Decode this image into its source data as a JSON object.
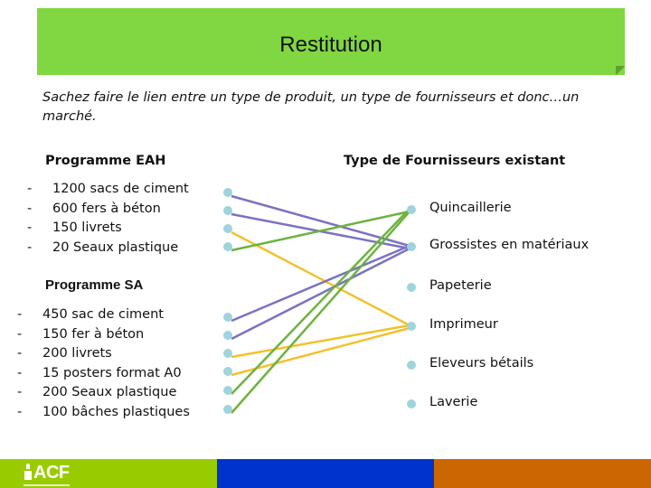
{
  "title": "Restitution",
  "intro": "Sachez faire le lien entre un type de produit, un type de fournisseurs et donc…un marché.",
  "programs": {
    "eah": {
      "heading": "Programme EAH",
      "items": [
        "1200 sacs de ciment",
        "600 fers à béton",
        "150 livrets",
        "20 Seaux plastique"
      ]
    },
    "sa": {
      "heading": "Programme SA",
      "items": [
        "450 sac de ciment",
        "150 fer à béton",
        "200 livrets",
        "15 posters format A0",
        "200 Seaux plastique",
        "100 bâches plastiques"
      ]
    }
  },
  "suppliers": {
    "heading": "Type de Fournisseurs existant",
    "items": [
      "Quincaillerie",
      "Grossistes en matériaux",
      "Papeterie",
      "Imprimeur",
      "Eleveurs bétails",
      "Laverie"
    ]
  },
  "bullet_marker": "-",
  "colors": {
    "banner": "#80d742",
    "node": "#9fd4dc",
    "link_purple": "#7b73c0",
    "link_green": "#6db33f",
    "link_yellow": "#f2c12e",
    "footer_green": "#99cc00",
    "footer_blue": "#0033cc",
    "footer_orange": "#cc6600"
  },
  "links": [
    {
      "from": "eah.0",
      "to": "supplier.1",
      "color": "link_purple"
    },
    {
      "from": "eah.1",
      "to": "supplier.1",
      "color": "link_purple"
    },
    {
      "from": "eah.2",
      "to": "supplier.3",
      "color": "link_yellow"
    },
    {
      "from": "eah.3",
      "to": "supplier.0",
      "color": "link_green"
    },
    {
      "from": "sa.0",
      "to": "supplier.1",
      "color": "link_purple"
    },
    {
      "from": "sa.1",
      "to": "supplier.1",
      "color": "link_purple"
    },
    {
      "from": "sa.2",
      "to": "supplier.3",
      "color": "link_yellow"
    },
    {
      "from": "sa.3",
      "to": "supplier.3",
      "color": "link_yellow"
    },
    {
      "from": "sa.4",
      "to": "supplier.0",
      "color": "link_green"
    },
    {
      "from": "sa.5",
      "to": "supplier.0",
      "color": "link_green"
    }
  ],
  "footer": {
    "logo_text": "ACF"
  }
}
